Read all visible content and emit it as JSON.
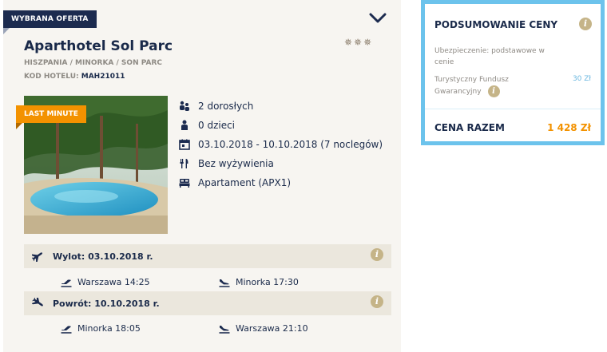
{
  "offer": {
    "badge": "WYBRANA OFERTA",
    "hotel_name": "Aparthotel Sol Parc",
    "stars": "✵✵✵",
    "location": "HISZPANIA / MINORKA / SON PARC",
    "code_label": "KOD HOTELU:",
    "code_value": "MAH21011",
    "last_minute": "LAST MINUTE",
    "details": {
      "adults": "2 dorosłych",
      "children": "0 dzieci",
      "dates": "03.10.2018 - 10.10.2018 (7 noclegów)",
      "board": "Bez wyżywienia",
      "room": "Apartament (APX1)"
    },
    "departure": {
      "label": "Wylot: 03.10.2018 r.",
      "from": "Warszawa 14:25",
      "to": "Minorka 17:30"
    },
    "return": {
      "label": "Powrót: 10.10.2018 r.",
      "from": "Minorka 18:05",
      "to": "Warszawa 21:10"
    }
  },
  "summary": {
    "title": "PODSUMOWANIE CENY",
    "insurance_line1": "Ubezpieczenie: podstawowe w",
    "insurance_line2": "cenie",
    "fund_line1": "Turystyczny Fundusz",
    "fund_line2": "Gwarancyjny",
    "fund_value": "30 Zł",
    "total_label": "CENA RAZEM",
    "total_value": "1 428 Zł"
  },
  "colors": {
    "navy": "#1c2b4f",
    "orange": "#f39200",
    "summary_border": "#6cc3ec",
    "info_icon": "#c5b488",
    "card_bg": "#f7f5f1"
  }
}
